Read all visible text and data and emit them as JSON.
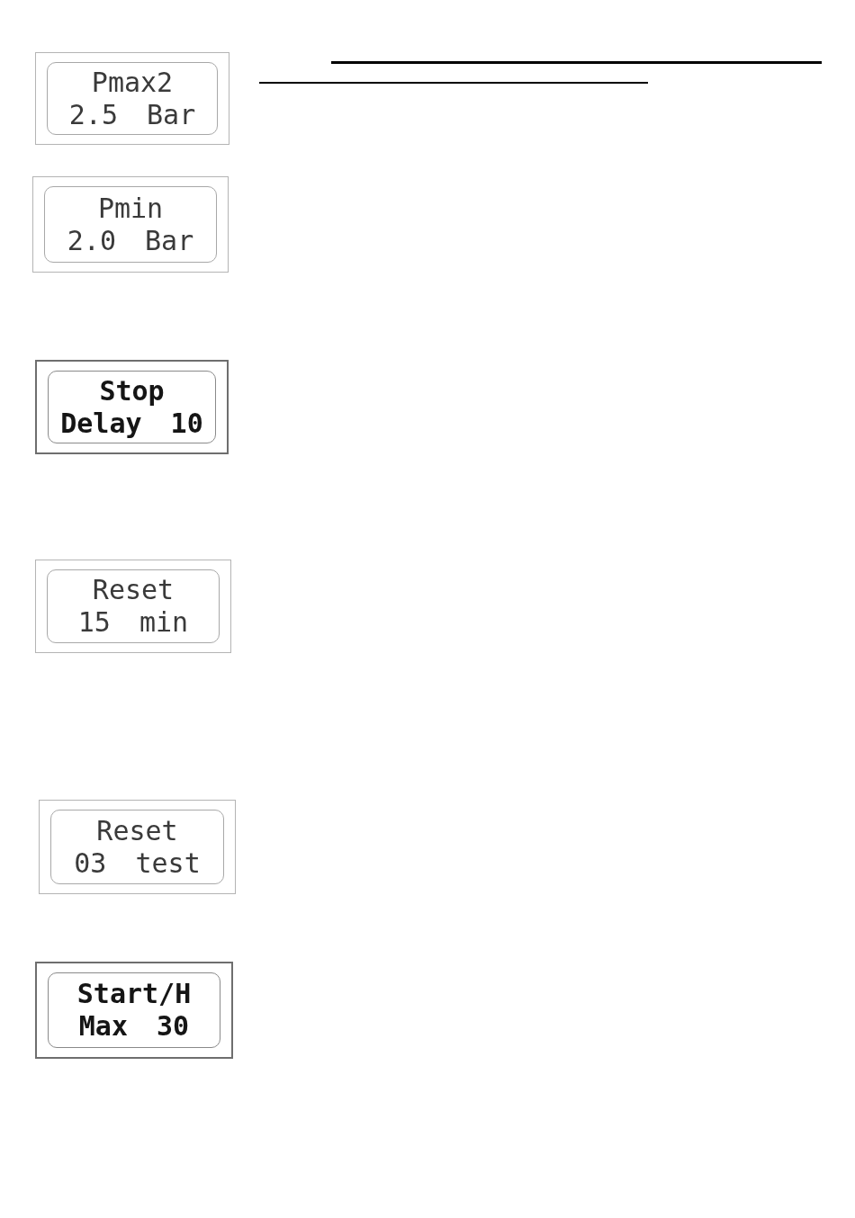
{
  "displays": [
    {
      "line_1": "Pmax2",
      "line_2": "2.5 Bar",
      "bold": false
    },
    {
      "line_1": "Pmin",
      "line_2": "2.0 Bar",
      "bold": false
    },
    {
      "line_1": "Stop",
      "line_2": "Delay 10",
      "bold": true
    },
    {
      "line_1": "Reset",
      "line_2": "15 min",
      "bold": false
    },
    {
      "line_1": "Reset",
      "line_2": "03 test",
      "bold": false
    },
    {
      "line_1": "Start/H",
      "line_2": "Max 30",
      "bold": true
    }
  ]
}
